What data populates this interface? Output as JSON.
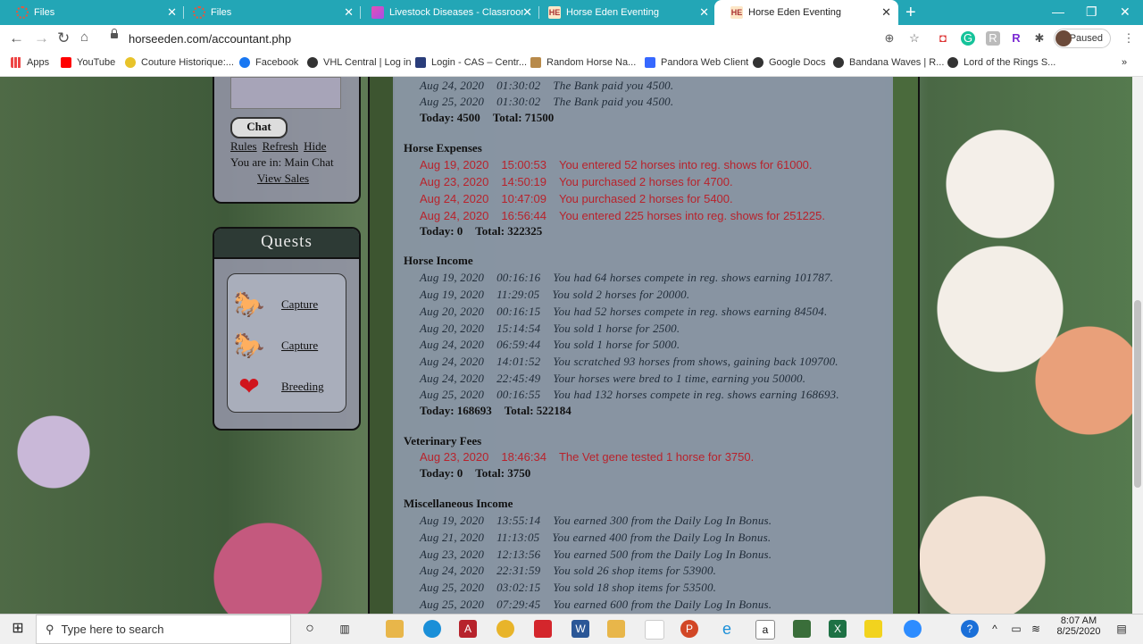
{
  "browser": {
    "tabs": [
      {
        "title": "Files",
        "icon": "files-icon"
      },
      {
        "title": "Files",
        "icon": "files-icon"
      },
      {
        "title": "Livestock Diseases - Classroom |",
        "icon": "classroom-icon"
      },
      {
        "title": "Horse Eden Eventing",
        "icon": "horse-eden-icon"
      },
      {
        "title": "Horse Eden Eventing",
        "icon": "horse-eden-icon"
      }
    ],
    "favicon_text": "HE",
    "url": "horseeden.com/accountant.php",
    "profile_status": "Paused",
    "bookmarks": [
      {
        "label": "Apps"
      },
      {
        "label": "YouTube"
      },
      {
        "label": "Couture Historique:..."
      },
      {
        "label": "Facebook"
      },
      {
        "label": "VHL Central | Log in"
      },
      {
        "label": "Login - CAS – Centr..."
      },
      {
        "label": "Random Horse Na..."
      },
      {
        "label": "Pandora Web Client"
      },
      {
        "label": "Google Docs"
      },
      {
        "label": "Bandana Waves | R..."
      },
      {
        "label": "Lord of the Rings S..."
      }
    ],
    "bookmarks_more": "»"
  },
  "chat": {
    "button": "Chat",
    "links": [
      "Rules",
      "Refresh",
      "Hide"
    ],
    "location": "You are in: Main Chat",
    "view_sales": "View Sales"
  },
  "quests": {
    "title": "Quests",
    "items": [
      {
        "label": "Capture",
        "icon": "horse-icon"
      },
      {
        "label": "Capture",
        "icon": "horse-icon"
      },
      {
        "label": "Breeding",
        "icon": "heart-icon"
      }
    ]
  },
  "ledger": {
    "top_rows": [
      {
        "date": "Aug 24, 2020",
        "time": "01:30:02",
        "msg": "The Bank paid you 4500."
      },
      {
        "date": "Aug 25, 2020",
        "time": "01:30:02",
        "msg": "The Bank paid you 4500."
      }
    ],
    "top_total": {
      "today": "Today: 4500",
      "total": "Total: 71500"
    },
    "horse_expenses": {
      "title": "Horse Expenses",
      "rows": [
        {
          "date": "Aug 19, 2020",
          "time": "15:00:53",
          "msg": "You entered 52 horses into reg. shows for 61000."
        },
        {
          "date": "Aug 23, 2020",
          "time": "14:50:19",
          "msg": "You purchased 2 horses for 4700."
        },
        {
          "date": "Aug 24, 2020",
          "time": "10:47:09",
          "msg": "You purchased 2 horses for 5400."
        },
        {
          "date": "Aug 24, 2020",
          "time": "16:56:44",
          "msg": "You entered 225 horses into reg. shows for 251225."
        }
      ],
      "today": "Today: 0",
      "total": "Total: 322325"
    },
    "horse_income": {
      "title": "Horse Income",
      "rows": [
        {
          "date": "Aug 19, 2020",
          "time": "00:16:16",
          "msg": "You had 64 horses compete in reg. shows earning 101787."
        },
        {
          "date": "Aug 19, 2020",
          "time": "11:29:05",
          "msg": "You sold 2 horses for 20000."
        },
        {
          "date": "Aug 20, 2020",
          "time": "00:16:15",
          "msg": "You had 52 horses compete in reg. shows earning 84504."
        },
        {
          "date": "Aug 20, 2020",
          "time": "15:14:54",
          "msg": "You sold 1 horse for 2500."
        },
        {
          "date": "Aug 24, 2020",
          "time": "06:59:44",
          "msg": "You sold 1 horse for 5000."
        },
        {
          "date": "Aug 24, 2020",
          "time": "14:01:52",
          "msg": "You scratched 93 horses from shows, gaining back 109700."
        },
        {
          "date": "Aug 24, 2020",
          "time": "22:45:49",
          "msg": "Your horses were bred to 1 time, earning you 50000."
        },
        {
          "date": "Aug 25, 2020",
          "time": "00:16:55",
          "msg": "You had 132 horses compete in reg. shows earning 168693."
        }
      ],
      "today": "Today: 168693",
      "total": "Total: 522184"
    },
    "vet_fees": {
      "title": "Veterinary Fees",
      "rows": [
        {
          "date": "Aug 23, 2020",
          "time": "18:46:34",
          "msg": "The Vet gene tested 1 horse for 3750."
        }
      ],
      "today": "Today: 0",
      "total": "Total: 3750"
    },
    "misc_income": {
      "title": "Miscellaneous Income",
      "rows": [
        {
          "date": "Aug 19, 2020",
          "time": "13:55:14",
          "msg": "You earned 300 from the Daily Log In Bonus."
        },
        {
          "date": "Aug 21, 2020",
          "time": "11:13:05",
          "msg": "You earned 400 from the Daily Log In Bonus."
        },
        {
          "date": "Aug 23, 2020",
          "time": "12:13:56",
          "msg": "You earned 500 from the Daily Log In Bonus."
        },
        {
          "date": "Aug 24, 2020",
          "time": "22:31:59",
          "msg": "You sold 26 shop items for 53900."
        },
        {
          "date": "Aug 25, 2020",
          "time": "03:02:15",
          "msg": "You sold 18 shop items for 53500."
        },
        {
          "date": "Aug 25, 2020",
          "time": "07:29:45",
          "msg": "You earned 600 from the Daily Log In Bonus."
        }
      ]
    }
  },
  "taskbar": {
    "search_placeholder": "Type here to search",
    "time": "8:07 AM",
    "date": "8/25/2020"
  },
  "colors": {
    "tab_strip": "#23a6b6",
    "expense_text": "#b8232c",
    "income_text": "#1f2b38",
    "ledger_bg": "#8a96a6"
  }
}
